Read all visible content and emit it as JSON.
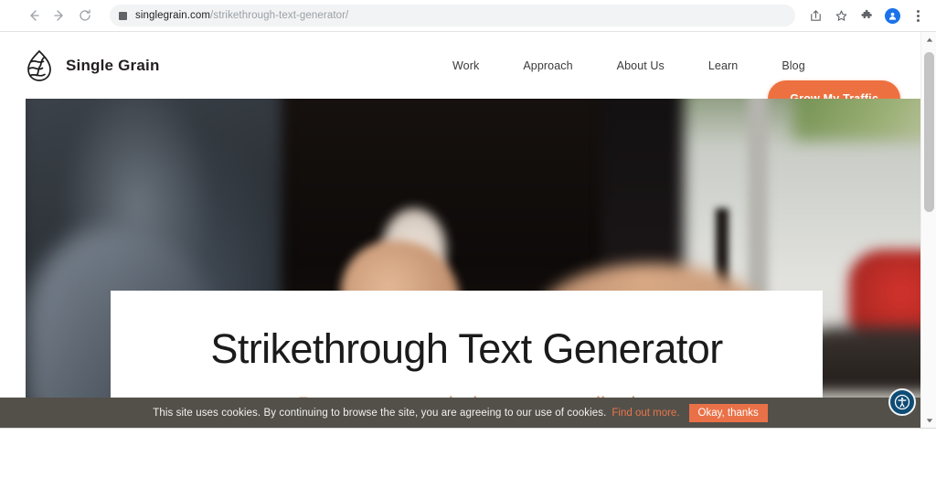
{
  "browser": {
    "back_label": "Back",
    "forward_label": "Forward",
    "reload_label": "Reload",
    "url_host": "singlegrain.com",
    "url_path": "/strikethrough-text-generator/",
    "site_info_label": "View site information",
    "share_label": "Share this page",
    "bookmark_label": "Bookmark this tab",
    "extensions_label": "Extensions",
    "profile_label": "Profile",
    "menu_label": "Customize and control Google Chrome"
  },
  "site": {
    "brand_name": "Single Grain",
    "logo_name": "single-grain-grain-logo",
    "nav": [
      {
        "label": "Work"
      },
      {
        "label": "Approach"
      },
      {
        "label": "About Us"
      },
      {
        "label": "Learn"
      },
      {
        "label": "Blog"
      }
    ],
    "cta_label": "Grow My Traffic",
    "cta_color": "#ed7140"
  },
  "hero": {
    "title": "Strikethrough Text Generator",
    "subtitle_prefix": "Paste your text below to get ",
    "subtitle_struck": "striked",
    "subtitle_color": "#d08a64"
  },
  "cookie_banner": {
    "message": "This site uses cookies. By continuing to browse the site, you are agreeing to our use of cookies.",
    "link_label": "Find out more.",
    "accept_label": "Okay, thanks",
    "background": "#53504a",
    "accept_color": "#ea7147"
  },
  "accessibility_widget": {
    "icon_name": "accessibility-person-icon",
    "color": "#0f4c75"
  },
  "scrollbar": {
    "up_label": "Scroll up",
    "down_label": "Scroll down",
    "thumb_label": "Vertical scrollbar thumb"
  }
}
